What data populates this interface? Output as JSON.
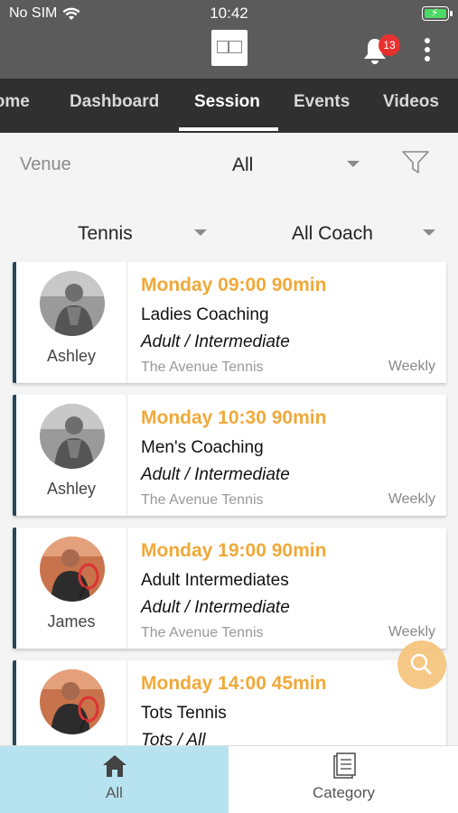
{
  "status": {
    "carrier": "No SIM",
    "time": "10:42"
  },
  "header": {
    "notification_count": "13"
  },
  "tabs": [
    {
      "label": "Home"
    },
    {
      "label": "Dashboard"
    },
    {
      "label": "Session"
    },
    {
      "label": "Events"
    },
    {
      "label": "Videos"
    }
  ],
  "filters": {
    "venue_label": "Venue",
    "venue_value": "All",
    "sport_value": "Tennis",
    "coach_value": "All Coach"
  },
  "sessions": [
    {
      "coach": "Ashley",
      "time": "Monday 09:00 90min",
      "title": "Ladies Coaching",
      "level": "Adult / Intermediate",
      "venue": "The Avenue Tennis",
      "frequency": "Weekly"
    },
    {
      "coach": "Ashley",
      "time": "Monday 10:30 90min",
      "title": "Men's Coaching",
      "level": "Adult / Intermediate",
      "venue": "The Avenue Tennis",
      "frequency": "Weekly"
    },
    {
      "coach": "James",
      "time": "Monday 19:00 90min",
      "title": "Adult Intermediates",
      "level": "Adult / Intermediate",
      "venue": "The Avenue Tennis",
      "frequency": "Weekly"
    },
    {
      "coach": "",
      "time": "Monday 14:00 45min",
      "title": "Tots Tennis",
      "level": "Tots / All",
      "venue": "",
      "frequency": ""
    }
  ],
  "bottom_nav": {
    "all_label": "All",
    "category_label": "Category"
  },
  "colors": {
    "accent": "#f0a93a",
    "header": "#5b5b5b",
    "tabbar": "#303030",
    "card_border": "#27465a",
    "active_bottom": "#b7e3f0",
    "badge": "#e8312f"
  },
  "icons": [
    "wifi-icon",
    "battery-icon",
    "bell-icon",
    "more-icon",
    "filter-icon",
    "search-icon",
    "home-icon",
    "category-icon"
  ]
}
